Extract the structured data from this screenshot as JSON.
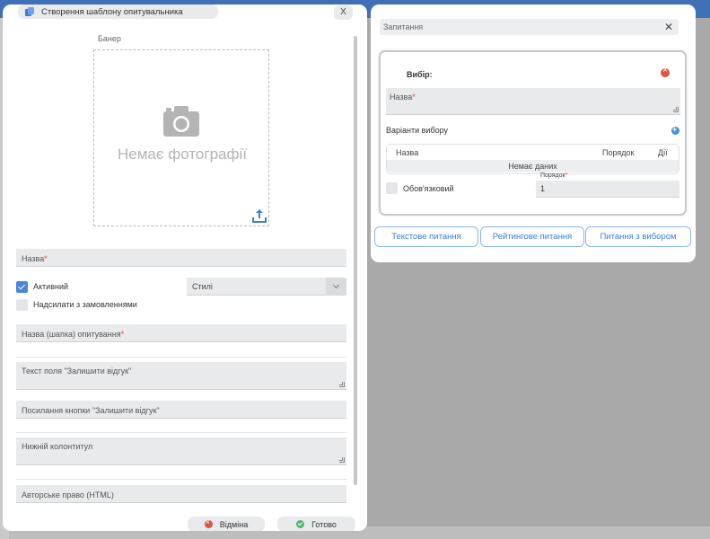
{
  "left_modal": {
    "title": "Створення шаблону опитувальника",
    "close": "X",
    "banner_label": "Банер",
    "no_photo": "Немає фотографії",
    "name_label": "Назва",
    "required_mark": "*",
    "active_label": "Активний",
    "active_checked": true,
    "send_with_orders_label": "Надсилати з замовленнями",
    "send_with_orders_checked": false,
    "styles_select": "Стилі",
    "survey_header_label": "Назва (шапка) опитування",
    "feedback_field_label": "Текст поля \"Залишити відгук\"",
    "feedback_link_label": "Посилання кнопки \"Залишити відгук\"",
    "footer_label": "Нижній колонтитул",
    "copyright_label": "Авторське право (HTML)",
    "cancel_button": "Відміна",
    "done_button": "Готово"
  },
  "right_modal": {
    "questions_header": "Запитання",
    "close": "✕",
    "choice": {
      "title": "Вибір:",
      "name_label": "Назва",
      "required_mark": "*",
      "options_label": "Варіанти вибору",
      "table_headers": [
        "Назва",
        "Порядок",
        "Дії"
      ],
      "no_data": "Немає даних",
      "required_label": "Обов'язковий",
      "required_checked": false,
      "order_label": "Порядок",
      "order_value": "1"
    },
    "add_buttons": [
      "Текстове питання",
      "Рейтингове питання",
      "Питання з вибором"
    ]
  },
  "colors": {
    "accent": "#3d7fd6",
    "danger": "#e0533f",
    "success": "#4cb86a",
    "field_bg": "#e8eaec"
  }
}
